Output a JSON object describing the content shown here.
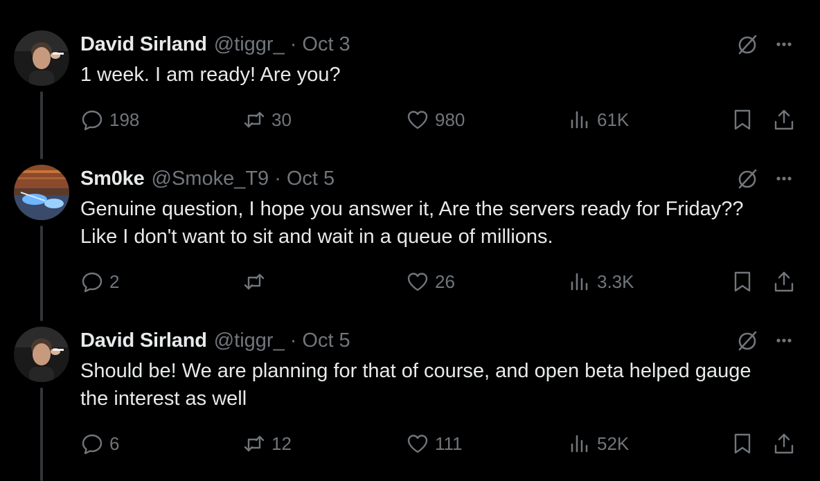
{
  "thread": {
    "tweets": [
      {
        "author_name": "David Sirland",
        "handle": "@tiggr_",
        "separator": "·",
        "date": "Oct 3",
        "lines": [
          "1 week. I am ready! Are you?"
        ],
        "replies": "198",
        "reposts": "30",
        "likes": "980",
        "views": "61K"
      },
      {
        "author_name": "Sm0ke",
        "handle": "@Smoke_T9",
        "separator": "·",
        "date": "Oct 5",
        "lines": [
          "Genuine question, I hope you answer it, Are the servers ready for Friday??",
          "Like I don't want to sit and wait in a queue of millions."
        ],
        "replies": "2",
        "reposts": "",
        "likes": "26",
        "views": "3.3K"
      },
      {
        "author_name": "David Sirland",
        "handle": "@tiggr_",
        "separator": "·",
        "date": "Oct 5",
        "lines": [
          "Should be! We are planning for that of course, and open beta helped gauge",
          "the interest as well"
        ],
        "replies": "6",
        "reposts": "12",
        "likes": "111",
        "views": "52K"
      }
    ]
  },
  "icons": {
    "reply": "reply-icon",
    "repost": "repost-icon",
    "like": "heart-icon",
    "views": "views-icon",
    "bookmark": "bookmark-icon",
    "share": "share-icon",
    "grok": "grok-icon",
    "more": "more-icon"
  },
  "colors": {
    "background": "#000000",
    "text_primary": "#e7e9ea",
    "text_secondary": "#71767b",
    "thread_line": "#333639"
  }
}
